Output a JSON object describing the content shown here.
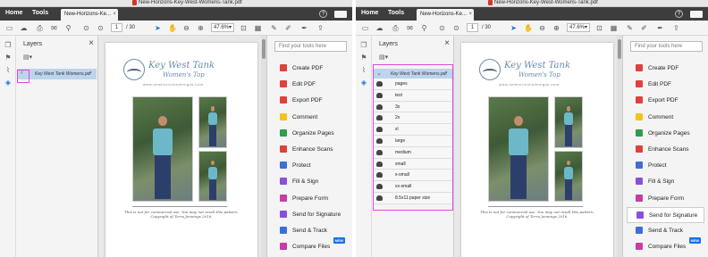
{
  "doc_title": "New-Horizons-Key-West-Womens-Tank.pdf",
  "tabs": {
    "home": "Home",
    "tools": "Tools",
    "doc_tab": "New-Horizons-Ke...",
    "help": "?"
  },
  "toolbar": {
    "page_current": "1",
    "page_total": "/ 30",
    "zoom": "47.6%"
  },
  "layers_panel": {
    "title": "Layers",
    "root_label": "Key West Tank Womens.pdf",
    "expanded_items": [
      "pages",
      "text",
      "3x",
      "2x",
      "xl",
      "large",
      "medium",
      "small",
      "x-small",
      "xx-small",
      "8.5x11 paper size"
    ]
  },
  "document": {
    "logo_title": "Key West Tank",
    "logo_subtitle": "Women's Top",
    "logo_url": "www.newhorizonsdesigns.com",
    "disclaimer_line1": "This is not for commercial use. You may not resell this pattern.",
    "disclaimer_line2": "Copyright of Terra Jennings 2016."
  },
  "tools_pane": {
    "search_placeholder": "Find your tools here",
    "items": [
      {
        "label": "Create PDF",
        "icon": "create-pdf-icon",
        "color": "#e0413a"
      },
      {
        "label": "Edit PDF",
        "icon": "edit-pdf-icon",
        "color": "#e0413a"
      },
      {
        "label": "Export PDF",
        "icon": "export-pdf-icon",
        "color": "#e0413a"
      },
      {
        "label": "Comment",
        "icon": "comment-icon",
        "color": "#f5c218"
      },
      {
        "label": "Organize Pages",
        "icon": "organize-pages-icon",
        "color": "#2d9e4a"
      },
      {
        "label": "Enhance Scans",
        "icon": "enhance-scans-icon",
        "color": "#e0413a"
      },
      {
        "label": "Protect",
        "icon": "protect-icon",
        "color": "#3d6fd6"
      },
      {
        "label": "Fill & Sign",
        "icon": "fill-sign-icon",
        "color": "#8a4fd8"
      },
      {
        "label": "Prepare Form",
        "icon": "prepare-form-icon",
        "color": "#c63ca8"
      },
      {
        "label": "Send for Signature",
        "icon": "send-signature-icon",
        "color": "#8a4fd8"
      },
      {
        "label": "Send & Track",
        "icon": "send-track-icon",
        "color": "#3d6fd6"
      },
      {
        "label": "Compare Files",
        "icon": "compare-files-icon",
        "color": "#c63ca8"
      }
    ],
    "new_badge": "NEW"
  },
  "colors": {
    "accent": "#1473e6",
    "highlight": "#e04ae0",
    "selected_layer": "#bcd4ec",
    "tabbar": "#3d3d3d"
  }
}
